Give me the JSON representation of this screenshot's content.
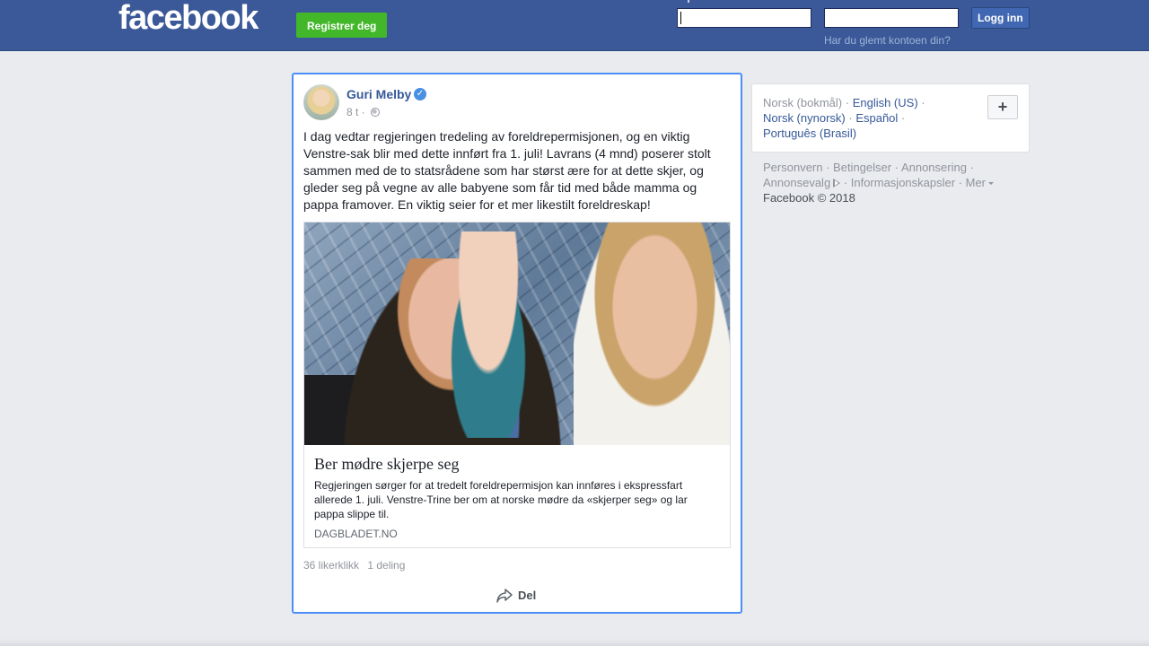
{
  "header": {
    "logo": "facebook",
    "register_label": "Registrer deg",
    "login_label": "Logg inn",
    "forgot_label": "Har du glemt kontoen din?",
    "email_value": "",
    "password_value": ""
  },
  "post": {
    "author": "Guri Melby",
    "verified_icon": "checkmark-icon",
    "time": "8 t",
    "separator": " · ",
    "privacy_icon": "globe-icon",
    "text": "I dag vedtar regjeringen tredeling av foreldrepermisjonen, og en viktig Venstre-sak blir med dette innført fra 1. juli! Lavrans (4 mnd) poserer stolt sammen med de to statsrådene som har størst ære for at dette skjer, og gleder seg på vegne av alle babyene som får tid med både mamma og pappa framover. En viktig seier for et mer likestilt foreldreskap!",
    "link_preview": {
      "title": "Ber mødre skjerpe seg",
      "description": "Regjeringen sørger for at tredelt foreldrepermisjon kan innføres i ekspressfart allerede 1. juli. Venstre-Trine ber om at norske mødre da «skjerper seg» og lar pappa slippe til.",
      "domain": "DAGBLADET.NO"
    },
    "stats": {
      "likes": "36 likerklikk",
      "shares": "1 deling"
    },
    "share_label": "Del"
  },
  "languages": {
    "current": "Norsk (bokmål)",
    "items": [
      "English (US)",
      "Norsk (nynorsk)",
      "Español",
      "Português (Brasil)"
    ],
    "add_label": "+"
  },
  "footer": {
    "links": [
      "Personvern",
      "Betingelser",
      "Annonsering",
      "Annonsevalg",
      "Informasjonskapsler",
      "Mer"
    ],
    "copyright": "Facebook © 2018"
  },
  "colors": {
    "header_bg": "#3b5998",
    "register_green": "#42b72a",
    "link_blue": "#365899",
    "focus_border": "#4c8ef7"
  }
}
